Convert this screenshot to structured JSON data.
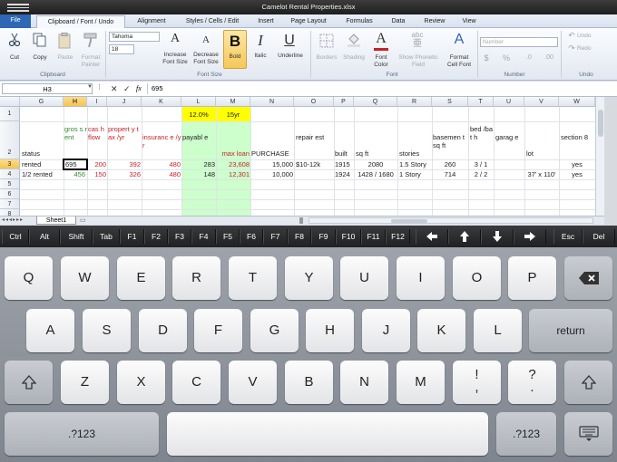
{
  "window": {
    "title": "Camelot Rental Properties.xlsx"
  },
  "tabs": [
    "File",
    "Clipboard / Font / Undo",
    "Alignment",
    "Styles / Cells / Edit",
    "Insert",
    "Page Layout",
    "Formulas",
    "Data",
    "Review",
    "View"
  ],
  "ribbon": {
    "clipboard": {
      "cut": "Cut",
      "copy": "Copy",
      "paste": "Paste",
      "format_painter": [
        "Format",
        "Painter"
      ],
      "label": "Clipboard"
    },
    "font": {
      "font_name": "Tahoma",
      "font_size": "18",
      "increase_glyph": "A",
      "increase": [
        "Increase",
        "Font Size"
      ],
      "decrease_glyph": "A",
      "decrease": [
        "Decrease",
        "Font Size"
      ],
      "bold_glyph": "B",
      "bold": "Bold",
      "italic_glyph": "I",
      "italic": "Italic",
      "underline_glyph": "U",
      "underline": "Underline",
      "borders": "Borders",
      "shading": "Shading",
      "font_color_glyph": "A",
      "font_color": [
        "Font",
        "Color"
      ],
      "phonetic_glyph": "abc",
      "phonetic_sub": "亜",
      "phonetic": [
        "Show Phonetic",
        "Field"
      ],
      "format_cell_font_glyph": "A",
      "format_cell_font": [
        "Format",
        "Cell Font"
      ],
      "size_label": "Font Size",
      "label": "Font"
    },
    "number": {
      "format": "Number",
      "dollar": "$",
      "percent": "%",
      "label": "Number"
    },
    "undo": {
      "undo": "Undo",
      "redo": "Redo",
      "label": "Undo"
    }
  },
  "formula_bar": {
    "name_box": "H3",
    "value": "695",
    "fx": "fx"
  },
  "grid": {
    "columns": [
      "G",
      "H",
      "I",
      "J",
      "K",
      "L",
      "M",
      "N",
      "O",
      "P",
      "Q",
      "R",
      "S",
      "T",
      "U",
      "V",
      "W"
    ],
    "rows": [
      "1",
      "2",
      "3",
      "4",
      "5",
      "6",
      "7",
      "8",
      "9"
    ],
    "row1": {
      "L": "12.0%",
      "M": "15yr"
    },
    "row2": {
      "G": "status",
      "H": "gros s rent",
      "I": "cas h flow",
      "J": "propert y tax /yr",
      "K": "insuranc e /yr",
      "L": "payabl e",
      "M": "max loan",
      "N": "PURCHASE",
      "O": "repair est",
      "P": "built",
      "Q": "sq ft",
      "R": "stories",
      "S": "basemen t sq ft",
      "T": "bed /bat h",
      "U": "garag e",
      "V": "lot",
      "W": "section 8"
    },
    "row3": {
      "G": "rented",
      "H": "695",
      "I": "200",
      "J": "392",
      "K": "480",
      "L": "283",
      "M": "23,608",
      "N": "15,000",
      "O": "$10-12k",
      "P": "1915",
      "Q": "2080",
      "R": "1.5 Story",
      "S": "260",
      "T": "3 / 1",
      "W": "yes"
    },
    "row4": {
      "G": "1/2 rented",
      "H": "456",
      "I": "150",
      "J": "326",
      "K": "480",
      "L": "148",
      "M": "12,301",
      "N": "10,000",
      "P": "1924",
      "Q": "1428 / 1680",
      "R": "1 Story",
      "S": "714",
      "T": "2 / 2",
      "V": "37' x 110'",
      "W": "yes"
    }
  },
  "sheet_tab": "Sheet1",
  "function_keys": [
    "Ctrl",
    "Alt",
    "Shift",
    "Tab",
    "F1",
    "F2",
    "F3",
    "F4",
    "F5",
    "F6",
    "F7",
    "F8",
    "F9",
    "F10",
    "F11",
    "F12",
    "Esc",
    "Del"
  ],
  "keyboard": {
    "row1": [
      "Q",
      "W",
      "E",
      "R",
      "T",
      "Y",
      "U",
      "I",
      "O",
      "P"
    ],
    "row2": [
      "A",
      "S",
      "D",
      "F",
      "G",
      "H",
      "J",
      "K",
      "L"
    ],
    "return": "return",
    "row3": [
      "Z",
      "X",
      "C",
      "V",
      "B",
      "N",
      "M"
    ],
    "excl": [
      "!",
      ","
    ],
    "quest": [
      "?",
      "."
    ],
    "numbers": ".?123"
  },
  "colors": {
    "selected_header": "#f6c450",
    "highlight_yellow": "#ffff00",
    "highlight_green": "#ccffcc",
    "green_text": "#2f8a2f",
    "red_text": "#c8202a",
    "ribbon_accent": "#2d67b5"
  }
}
